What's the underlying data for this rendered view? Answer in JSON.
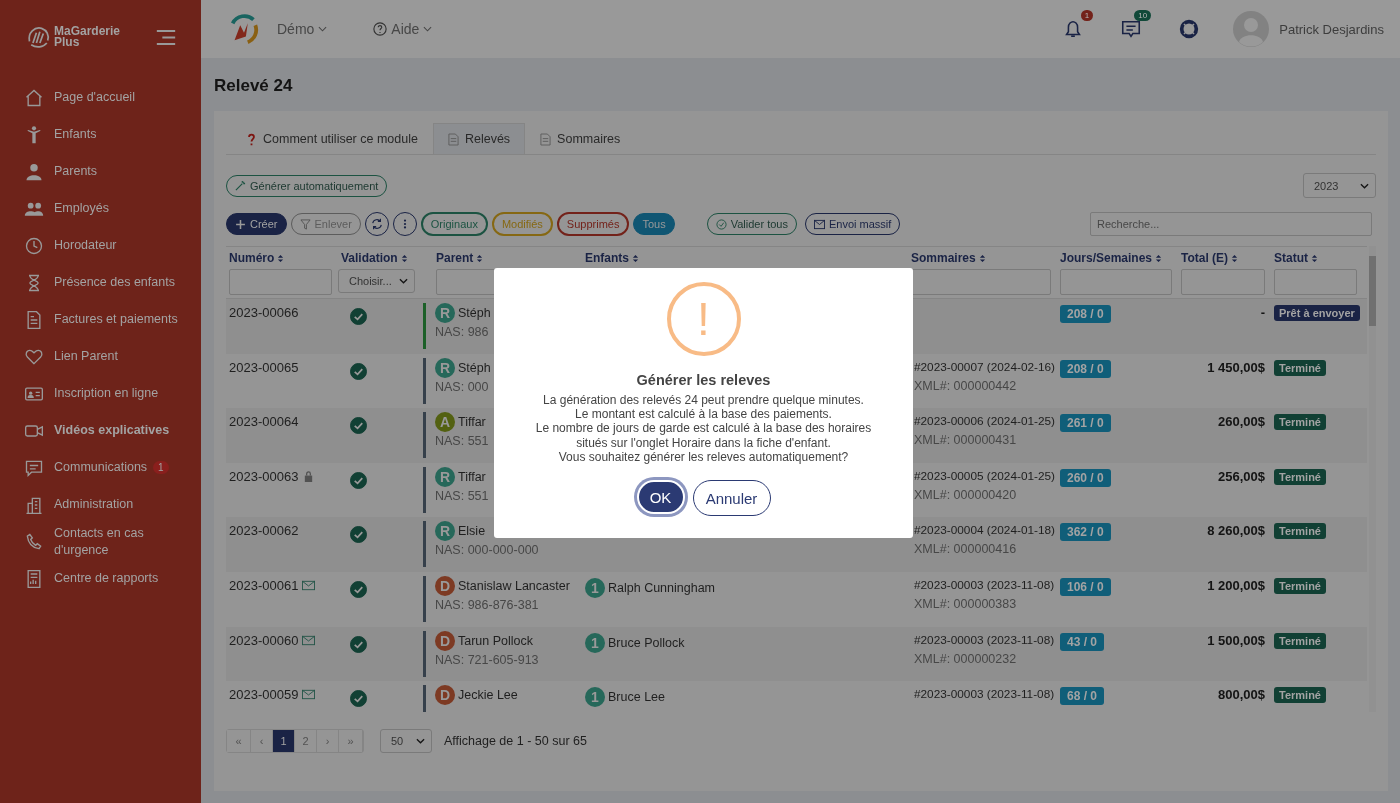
{
  "brand": "MaGarderie Plus",
  "sidebar": {
    "items": [
      {
        "label": "Page d'accueil",
        "selected": false
      },
      {
        "label": "Enfants",
        "selected": false
      },
      {
        "label": "Parents",
        "selected": false
      },
      {
        "label": "Employés",
        "selected": false
      },
      {
        "label": "Horodateur",
        "selected": false
      },
      {
        "label": "Présence des enfants",
        "selected": false
      },
      {
        "label": "Factures et paiements",
        "selected": false
      },
      {
        "label": "Lien Parent",
        "selected": false
      },
      {
        "label": "Inscription en ligne",
        "selected": false
      },
      {
        "label": "Vidéos explicatives",
        "selected": true
      },
      {
        "label": "Communications",
        "selected": false,
        "badge": "1"
      },
      {
        "label": "Administration",
        "selected": false
      },
      {
        "label": "Contacts en cas d'urgence",
        "selected": false
      },
      {
        "label": "Centre de rapports",
        "selected": false
      }
    ]
  },
  "header": {
    "org": "Démo",
    "help": "Aide",
    "notifications": "1",
    "messages": "10",
    "user": "Patrick Desjardins"
  },
  "page_title": "Relevé 24",
  "tabs": [
    {
      "label": "Comment utiliser ce module",
      "selected": false
    },
    {
      "label": "Relevés",
      "selected": true
    },
    {
      "label": "Sommaires",
      "selected": false
    }
  ],
  "generate_button": "Générer automatiquement",
  "year_select": "2023",
  "toolbar": {
    "create": "Créer",
    "remove": "Enlever",
    "filters": [
      {
        "label": "Originaux",
        "selected": false,
        "color": "#1c5342"
      },
      {
        "label": "Modifiés",
        "selected": false,
        "color": "#866813"
      },
      {
        "label": "Supprimés",
        "selected": false,
        "color": "#73221a"
      },
      {
        "label": "Tous",
        "selected": true,
        "color": "#105673"
      }
    ],
    "validate_all": "Valider tous",
    "mass_send": "Envoi massif",
    "search_placeholder": "Recherche..."
  },
  "table": {
    "columns": [
      "Numéro",
      "Validation",
      "Parent",
      "Enfants",
      "Sommaires",
      "Jours/Semaines",
      "Total (E)",
      "Statut"
    ],
    "validation_filter": "Choisir...",
    "rows": [
      {
        "number": "2023-00066",
        "locked": false,
        "emailed": false,
        "validated": true,
        "color": "#1c6028",
        "parent": {
          "initial": "R",
          "color": "#26685a",
          "name": "Stéph",
          "nas": "NAS: 986"
        },
        "days": "208 / 0",
        "total": "-",
        "status": {
          "kind": "ready",
          "label": "Prêt à envoyer"
        }
      },
      {
        "number": "2023-00065",
        "locked": false,
        "emailed": false,
        "validated": true,
        "color": "#36404b",
        "parent": {
          "initial": "R",
          "color": "#26685a",
          "name": "Stéph",
          "nas": "NAS: 000"
        },
        "summary": "#2023-00007 (2024-02-16)",
        "xml": "XML#: 000000442",
        "days": "208 / 0",
        "total": "1 450,00$",
        "status": {
          "kind": "done",
          "label": "Terminé"
        }
      },
      {
        "number": "2023-00064",
        "locked": false,
        "emailed": false,
        "validated": true,
        "color": "#36404b",
        "parent": {
          "initial": "A",
          "color": "#536111",
          "name": "Tiffar",
          "nas": "NAS: 551"
        },
        "summary": "#2023-00006 (2024-01-25)",
        "xml": "XML#: 000000431",
        "days": "261 / 0",
        "total": "260,00$",
        "status": {
          "kind": "done",
          "label": "Terminé"
        }
      },
      {
        "number": "2023-00063",
        "locked": true,
        "emailed": false,
        "validated": true,
        "color": "#36404b",
        "parent": {
          "initial": "R",
          "color": "#26685a",
          "name": "Tiffar",
          "nas": "NAS: 551"
        },
        "summary": "#2023-00005 (2024-01-25)",
        "xml": "XML#: 000000420",
        "days": "260 / 0",
        "total": "256,00$",
        "status": {
          "kind": "done",
          "label": "Terminé"
        }
      },
      {
        "number": "2023-00062",
        "locked": false,
        "emailed": false,
        "validated": true,
        "color": "#36404b",
        "parent": {
          "initial": "R",
          "color": "#26685a",
          "name": "Elsie",
          "nas": "NAS: 000-000-000"
        },
        "summary": "#2023-00004 (2024-01-18)",
        "xml": "XML#: 000000416",
        "days": "362 / 0",
        "total": "8 260,00$",
        "status": {
          "kind": "done",
          "label": "Terminé"
        }
      },
      {
        "number": "2023-00061",
        "locked": false,
        "emailed": true,
        "validated": true,
        "color": "#36404b",
        "parent": {
          "initial": "D",
          "color": "#7d3a23",
          "name": "Stanislaw Lancaster",
          "nas": "NAS: 986-876-381"
        },
        "child": {
          "initial": "1",
          "color": "#26685a",
          "name": "Ralph Cunningham"
        },
        "summary": "#2023-00003 (2023-11-08)",
        "xml": "XML#: 000000383",
        "days": "106 / 0",
        "total": "1 200,00$",
        "status": {
          "kind": "done",
          "label": "Terminé"
        }
      },
      {
        "number": "2023-00060",
        "locked": false,
        "emailed": true,
        "validated": true,
        "color": "#36404b",
        "parent": {
          "initial": "D",
          "color": "#7d3a23",
          "name": "Tarun Pollock",
          "nas": "NAS: 721-605-913"
        },
        "child": {
          "initial": "1",
          "color": "#26685a",
          "name": "Bruce Pollock"
        },
        "summary": "#2023-00003 (2023-11-08)",
        "xml": "XML#: 000000232",
        "days": "43 / 0",
        "total": "1 500,00$",
        "status": {
          "kind": "done",
          "label": "Terminé"
        }
      },
      {
        "number": "2023-00059",
        "locked": false,
        "emailed": true,
        "validated": true,
        "color": "#36404b",
        "parent": {
          "initial": "D",
          "color": "#7d3a23",
          "name": "Jeckie Lee"
        },
        "child": {
          "initial": "1",
          "color": "#26685a",
          "name": "Bruce Lee"
        },
        "summary": "#2023-00003 (2023-11-08)",
        "days": "68 / 0",
        "total": "800,00$",
        "status": {
          "kind": "done",
          "label": "Terminé"
        }
      }
    ]
  },
  "pagination": {
    "first": "«",
    "prev": "‹",
    "pages": [
      {
        "label": "1",
        "selected": true
      },
      {
        "label": "2",
        "selected": false
      }
    ],
    "next": "›",
    "last": "»",
    "page_size": "50",
    "info": "Affichage de 1 - 50 sur 65"
  },
  "modal": {
    "icon": "!",
    "title": "Générer les releves",
    "message": "La génération des relevés 24 peut prendre quelque minutes.\nLe montant est calculé à la base des paiements.\nLe nombre de jours de garde est calculé à la base des horaires\nsitués sur l'onglet Horaire dans la fiche d'enfant.\nVous souhaitez générer les releves automatiquement?",
    "confirm": "OK",
    "cancel": "Annuler"
  }
}
